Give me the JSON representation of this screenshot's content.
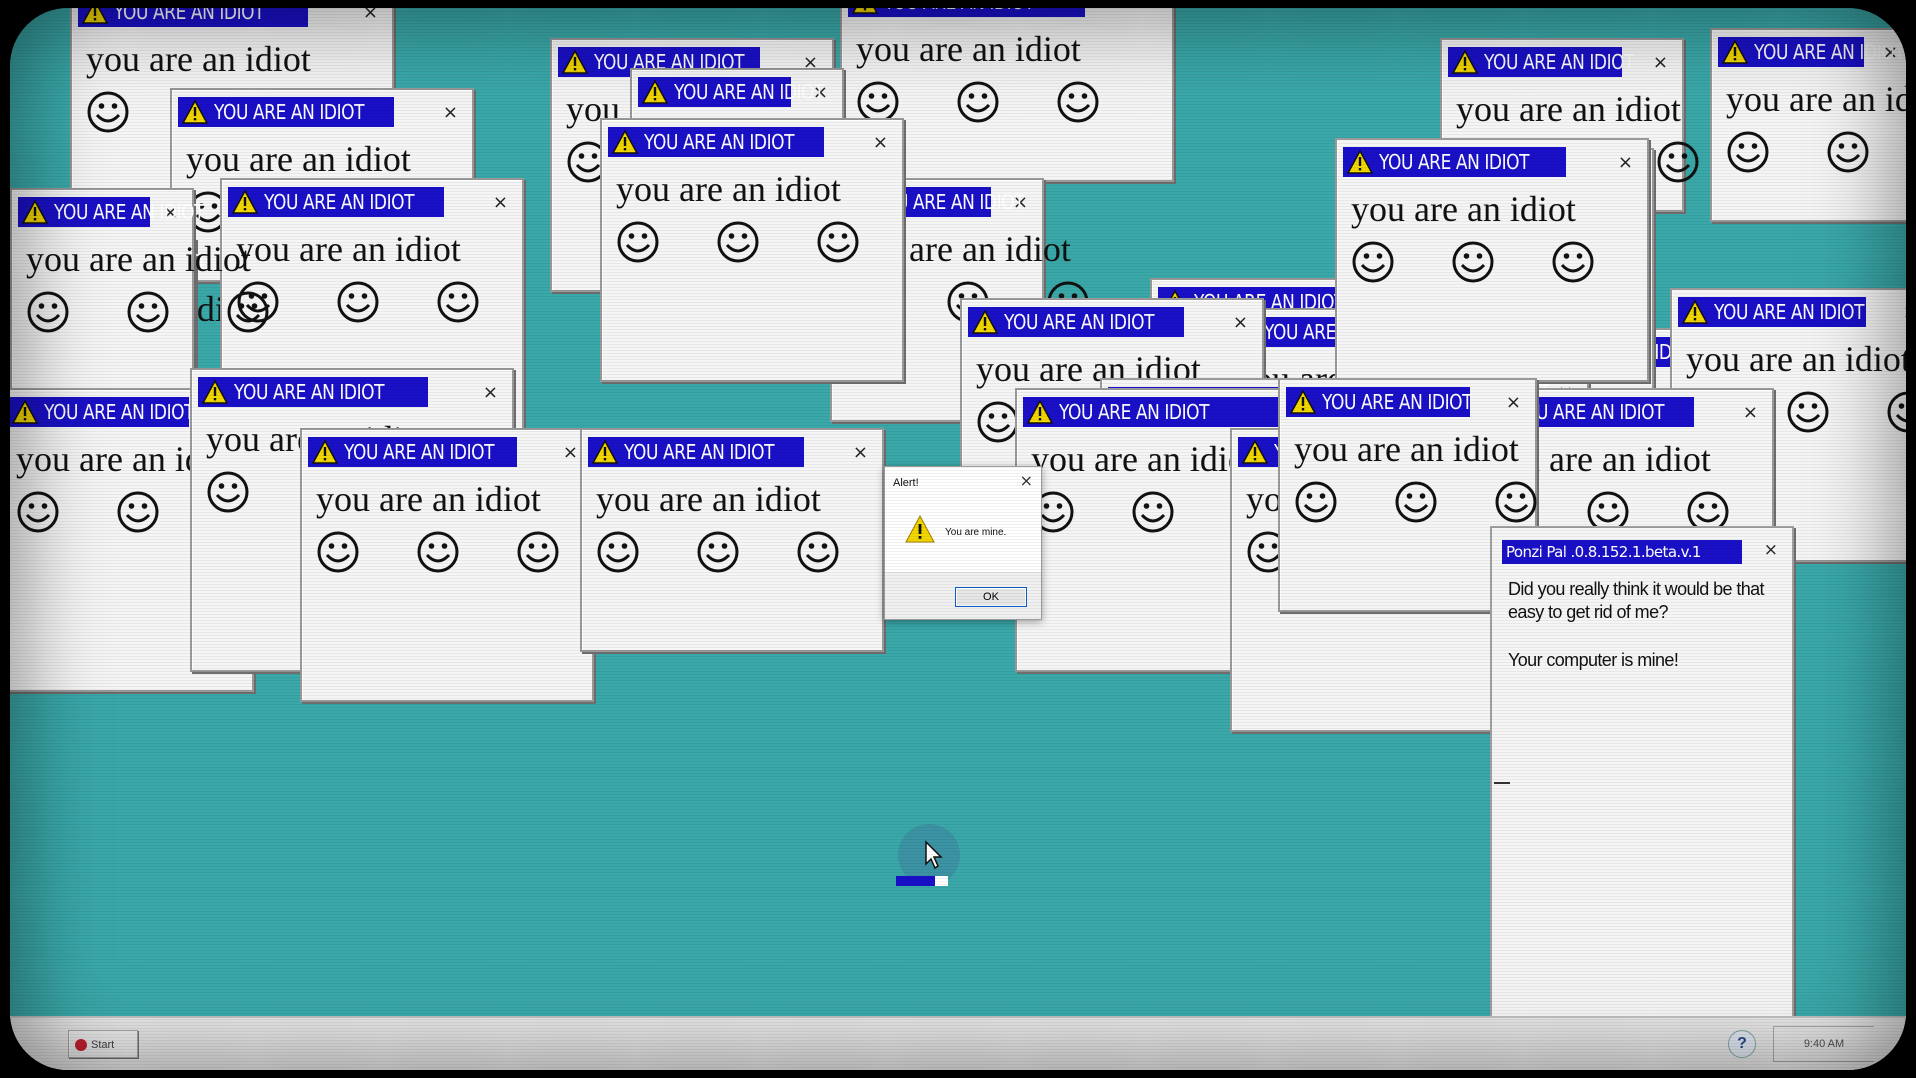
{
  "popup": {
    "title": "YOU ARE AN IDIOT",
    "body": "you are an idiot",
    "close": "×"
  },
  "alert": {
    "title": "Alert!",
    "message": "You are mine.",
    "ok_label": "OK",
    "close": "×"
  },
  "ponzi": {
    "title": "Ponzi Pal .0.8.152.1.beta.v.1",
    "line1": "Did you really think it would be that easy to get rid of me?",
    "line2": "Your computer is mine!",
    "close": "×"
  },
  "taskbar": {
    "start_label": "Start",
    "clock": "9:40 AM",
    "help_label": "?"
  },
  "loader": {
    "progress": 0.75
  },
  "colors": {
    "desktop": "#3aa8a9",
    "titlebar": "#1a10c8",
    "window": "#f5f5f5",
    "warning": "#f2d600"
  },
  "icons": [
    "warning-icon",
    "smiley-icon",
    "close-icon",
    "cursor-icon",
    "help-icon"
  ]
}
